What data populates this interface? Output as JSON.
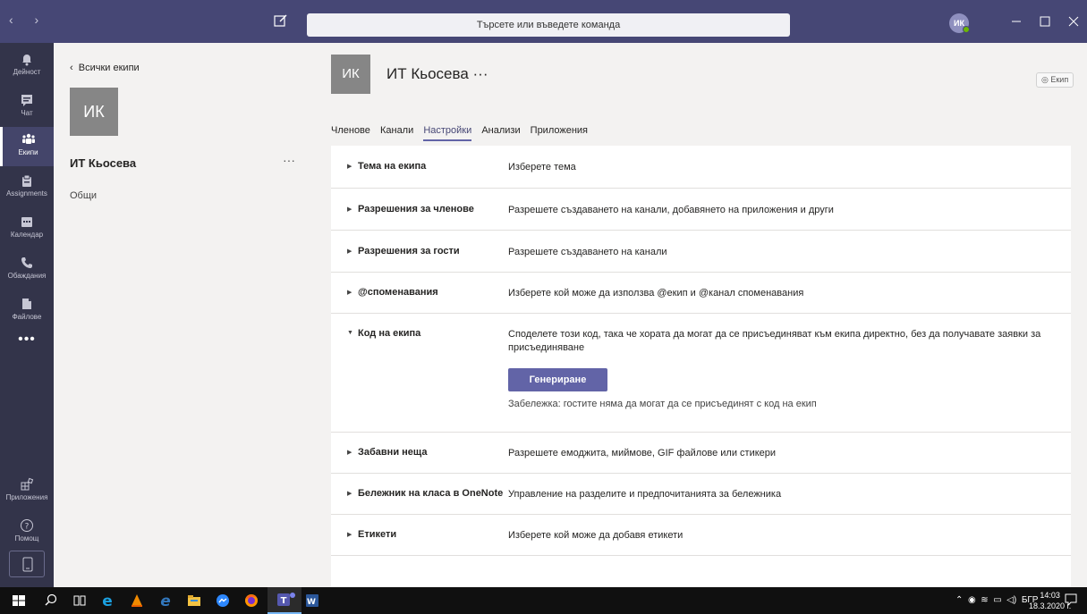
{
  "titlebar": {
    "nav_arrows": "‹ ›",
    "search_placeholder": "Търсете или въведете команда",
    "avatar_initials": "ИК",
    "accent": "#464775"
  },
  "rail": {
    "items": [
      {
        "label": "Дейност",
        "icon": "bell-icon"
      },
      {
        "label": "Чат",
        "icon": "chat-icon"
      },
      {
        "label": "Екипи",
        "icon": "teams-icon"
      },
      {
        "label": "Assignments",
        "icon": "assignments-icon"
      },
      {
        "label": "Календар",
        "icon": "calendar-icon"
      },
      {
        "label": "Обаждания",
        "icon": "phone-icon"
      },
      {
        "label": "Файлове",
        "icon": "files-icon"
      }
    ],
    "more": "•••",
    "bottom": [
      {
        "label": "Приложения",
        "icon": "apps-icon"
      },
      {
        "label": "Помощ",
        "icon": "help-icon"
      }
    ]
  },
  "leftpane": {
    "back_label": "Всички екипи",
    "tile_initials": "ИК",
    "team_name": "ИТ Кьосева",
    "more": "···",
    "channel": "Общи"
  },
  "main": {
    "tile_initials": "ИК",
    "title": "ИТ Кьосева ···",
    "team_badge": "◎ Екип",
    "tabs": [
      "Членове",
      "Канали",
      "Настройки",
      "Анализи",
      "Приложения"
    ],
    "active_tab": "Настройки",
    "settings": [
      {
        "name": "Тема на екипа",
        "desc": "Изберете тема"
      },
      {
        "name": "Разрешения за членове",
        "desc": "Разрешете създаването на канали, добавянето на приложения и други"
      },
      {
        "name": "Разрешения за гости",
        "desc": "Разрешете създаването на канали"
      },
      {
        "name": "@споменавания",
        "desc": "Изберете кой може да използва @екип и @канал споменавания"
      },
      {
        "name": "Код на екипа",
        "desc": "Споделете този код, така че хората да могат да се присъединяват към екипа директно, без да получавате заявки за присъединяване",
        "button": "Генериране",
        "note": "Забележка: гостите няма да могат да се присъединят с код на екип"
      },
      {
        "name": "Забавни неща",
        "desc": "Разрешете емоджита, миймове, GIF файлове или стикери"
      },
      {
        "name": "Бележник на класа в OneNote",
        "desc": "Управление на разделите и предпочитанията за бележника"
      },
      {
        "name": "Етикети",
        "desc": "Изберете кой може да добавя етикети"
      }
    ]
  },
  "taskbar": {
    "language": "БГР",
    "time": "14:03",
    "date": "18.3.2020 г."
  }
}
